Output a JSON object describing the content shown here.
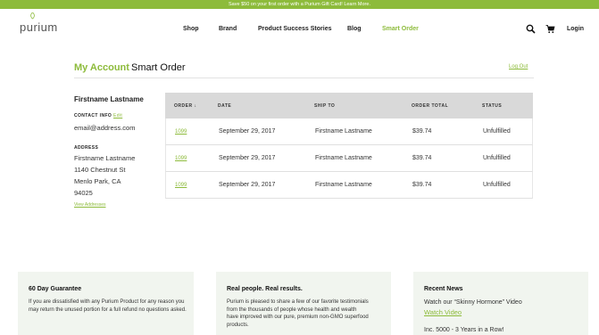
{
  "promo": {
    "text": "Save $50 on your first order with a Purium Gift Card! Learn More."
  },
  "header": {
    "logo": "purium",
    "nav": [
      "Shop",
      "Brand",
      "Product Success Stories",
      "Blog",
      "Smart Order"
    ],
    "search_icon": "search-icon",
    "cart_icon": "cart-icon",
    "login": "Login"
  },
  "account": {
    "tab_active": "My Account",
    "tab_other": "Smart Order",
    "logout": "Log Out"
  },
  "profile": {
    "name": "Firstname Lastname",
    "contact_label": "CONTACT INFO",
    "edit": "Edit",
    "email": "email@address.com",
    "address_label": "ADDRESS",
    "address_lines": [
      "Firstname Lastname",
      "1140 Chestnut St",
      "Menlo Park, CA",
      "94025"
    ],
    "view_addresses": "View Addresses"
  },
  "orders": {
    "headers": [
      "ORDER ↓",
      "DATE",
      "SHIP TO",
      "ORDER TOTAL",
      "STATUS"
    ],
    "rows": [
      {
        "order": "1099",
        "date": "September 29, 2017",
        "ship_to": "Firstname Lastname",
        "total": "$39.74",
        "status": "Unfulfilled"
      },
      {
        "order": "1099",
        "date": "September 29, 2017",
        "ship_to": "Firstname Lastname",
        "total": "$39.74",
        "status": "Unfulfilled"
      },
      {
        "order": "1099",
        "date": "September 29, 2017",
        "ship_to": "Firstname Lastname",
        "total": "$39.74",
        "status": "Unfulfilled"
      }
    ]
  },
  "footer": {
    "guarantee": {
      "title": "60 Day Guarantee",
      "text": "If you are dissatisfied with any Purium Product for any reason you may return the unused portion for a full refund no questions asked."
    },
    "real_people": {
      "title": "Real people. Real results.",
      "text": "Purium is pleased to share a few of our favorite testimonials from the thousands of people whose health and wealth have improved with our pure, premium non-GMO superfood products."
    },
    "news": {
      "title": "Recent News",
      "line1": "Watch our “Skinny Hormone” Video",
      "link": "Watch Video",
      "line2": "Inc. 5000 - 3 Years in a Row!"
    }
  },
  "colors": {
    "accent": "#8dbb3b",
    "promo_bg": "#8dbb3b",
    "footer_bg": "#f1f5ef",
    "table_head": "#d9d9d9"
  }
}
